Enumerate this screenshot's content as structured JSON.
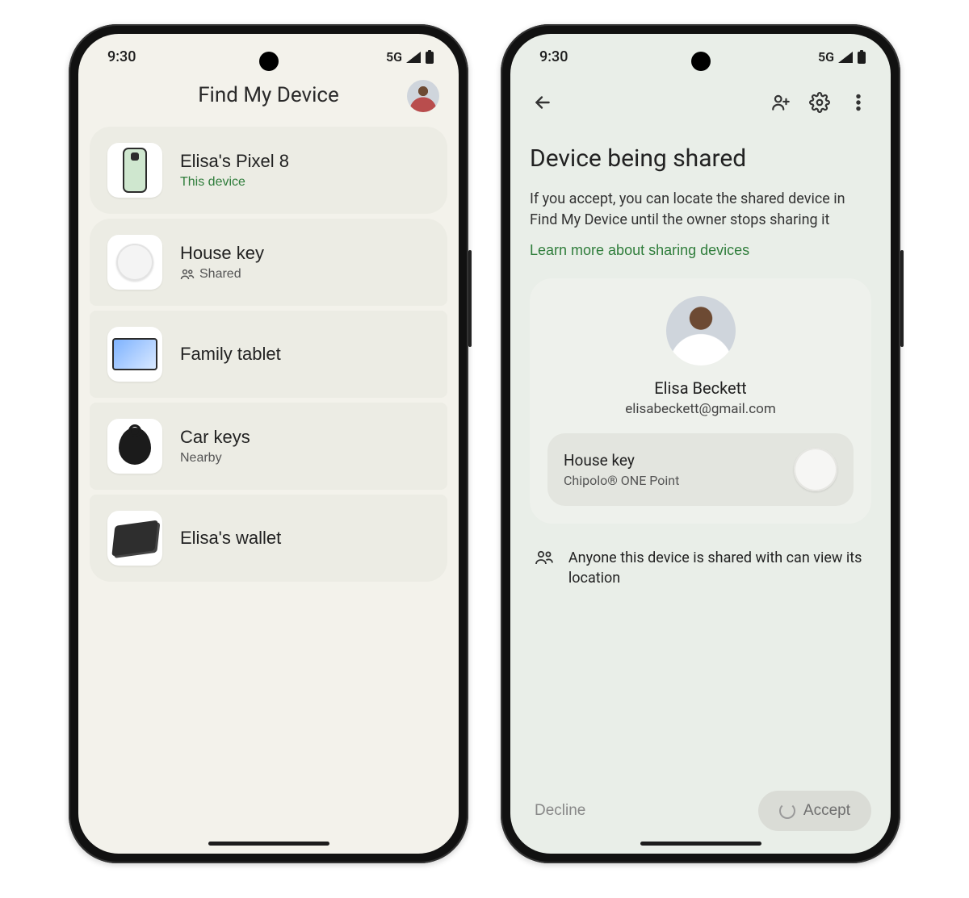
{
  "status": {
    "time": "9:30",
    "network": "5G"
  },
  "left": {
    "title": "Find My Device",
    "devices": [
      {
        "name": "Elisa's Pixel 8",
        "subtitle": "This device",
        "subtitle_style": "green",
        "icon": "pixel"
      },
      {
        "name": "House key",
        "subtitle": "Shared",
        "subtitle_style": "shared",
        "icon": "tag"
      },
      {
        "name": "Family tablet",
        "subtitle": "",
        "subtitle_style": "",
        "icon": "tablet"
      },
      {
        "name": "Car keys",
        "subtitle": "Nearby",
        "subtitle_style": "",
        "icon": "fob"
      },
      {
        "name": "Elisa's wallet",
        "subtitle": "",
        "subtitle_style": "",
        "icon": "wallet"
      }
    ]
  },
  "right": {
    "title": "Device being shared",
    "description": "If you accept, you can locate the shared device in Find My Device until the owner stops sharing it",
    "learn_more": "Learn more about sharing devices",
    "sharer": {
      "name": "Elisa Beckett",
      "email": "elisabeckett@gmail.com"
    },
    "device": {
      "name": "House key",
      "model": "Chipolo® ONE Point"
    },
    "info": "Anyone this device is shared with can view its location",
    "decline": "Decline",
    "accept": "Accept"
  }
}
